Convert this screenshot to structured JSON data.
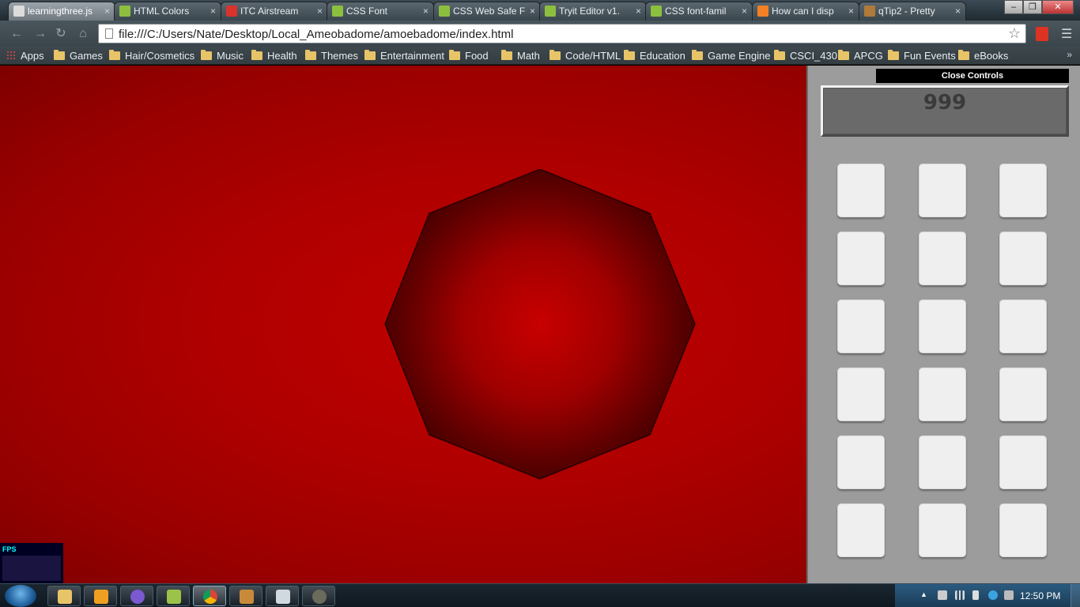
{
  "browser": {
    "tabs": [
      {
        "title": "learningthree.js",
        "icon": "page-icon",
        "color": "#dcdcdc"
      },
      {
        "title": "HTML Colors",
        "icon": "w3schools-icon",
        "color": "#8dbf3e"
      },
      {
        "title": "ITC Airstream",
        "icon": "fonts-icon",
        "color": "#d9332b"
      },
      {
        "title": "CSS Font",
        "icon": "w3schools-icon",
        "color": "#8dbf3e"
      },
      {
        "title": "CSS Web Safe F",
        "icon": "w3schools-icon",
        "color": "#8dbf3e"
      },
      {
        "title": "Tryit Editor v1.",
        "icon": "w3schools-icon",
        "color": "#8dbf3e"
      },
      {
        "title": "CSS font-famil",
        "icon": "w3schools-icon",
        "color": "#8dbf3e"
      },
      {
        "title": "How can I disp",
        "icon": "stackoverflow-icon",
        "color": "#f48024"
      },
      {
        "title": "qTip2 - Pretty",
        "icon": "owl-icon",
        "color": "#b07a3a"
      }
    ],
    "url": "file:///C:/Users/Nate/Desktop/Local_Ameobadome/amoebadome/index.html",
    "bookmarks": [
      {
        "label": "Apps",
        "type": "apps"
      },
      {
        "label": "Games",
        "type": "folder"
      },
      {
        "label": "Hair/Cosmetics",
        "type": "folder"
      },
      {
        "label": "Music",
        "type": "folder"
      },
      {
        "label": "Health",
        "type": "folder"
      },
      {
        "label": "Themes",
        "type": "folder"
      },
      {
        "label": "Entertainment",
        "type": "folder"
      },
      {
        "label": "Food",
        "type": "folder"
      },
      {
        "label": "Math",
        "type": "folder"
      },
      {
        "label": "Code/HTML",
        "type": "folder"
      },
      {
        "label": "Education",
        "type": "folder"
      },
      {
        "label": "Game Engine",
        "type": "folder"
      },
      {
        "label": "CSCI_430",
        "type": "folder"
      },
      {
        "label": "APCG",
        "type": "folder"
      },
      {
        "label": "Fun Events",
        "type": "folder"
      },
      {
        "label": "eBooks",
        "type": "folder"
      }
    ],
    "more_bookmarks": "»"
  },
  "game": {
    "background_color": "#b00000",
    "shape": "octagon",
    "fps_label": "FPS"
  },
  "controls": {
    "close_label": "Close Controls",
    "counter_value": "999",
    "button_count": 18
  },
  "taskbar": {
    "clock": "12:50 PM"
  }
}
